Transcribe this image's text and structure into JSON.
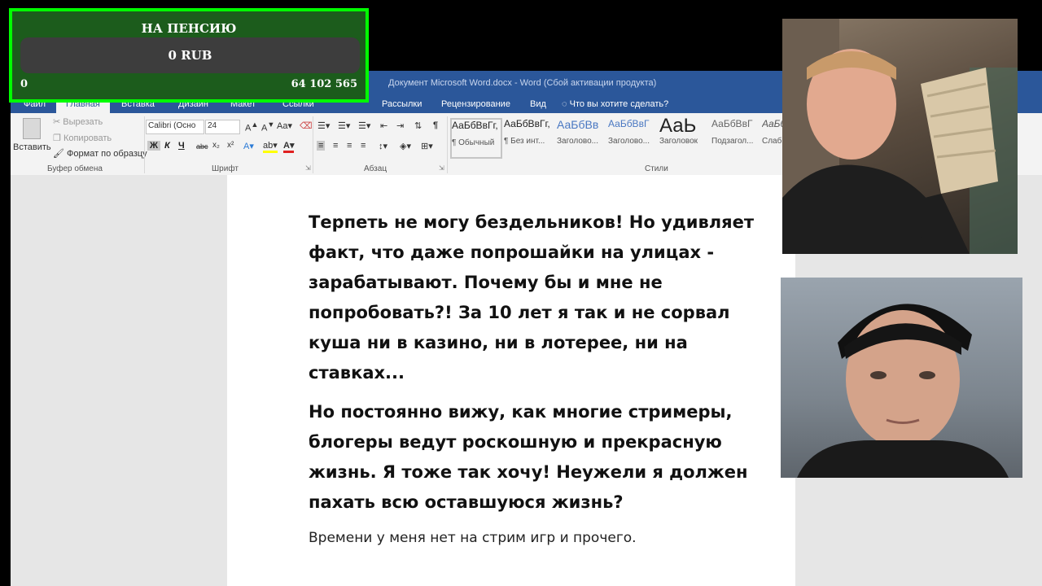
{
  "widget": {
    "title": "НА ПЕНСИЮ",
    "current": "0 RUB",
    "min": "0",
    "max": "64 102 565",
    "progress": 0
  },
  "word": {
    "window_title": "Документ Microsoft Word.docx - Word (Сбой активации продукта)",
    "tabs": [
      "Файл",
      "Главная",
      "Вставка",
      "Дизайн",
      "Макет",
      "Ссылки",
      "Рассылки",
      "Рецензирование",
      "Вид"
    ],
    "tell_me": "Что вы хотите сделать?",
    "clipboard": {
      "paste": "Вставить",
      "cut": "Вырезать",
      "copy": "Копировать",
      "format_painter": "Формат по образцу",
      "label": "Буфер обмена"
    },
    "font": {
      "name": "Calibri (Осно",
      "size": "24",
      "label": "Шрифт",
      "bold": "Ж",
      "italic": "К",
      "underline": "Ч",
      "strike": "abc"
    },
    "paragraph_label": "Абзац",
    "styles": {
      "label": "Стили",
      "items": [
        {
          "preview": "АаБбВвГг,",
          "name": "¶ Обычный"
        },
        {
          "preview": "АаБбВвГг,",
          "name": "¶ Без инт..."
        },
        {
          "preview": "АаБбВв",
          "name": "Заголово..."
        },
        {
          "preview": "АаБбВвГ",
          "name": "Заголово..."
        },
        {
          "preview": "АаЬ",
          "name": "Заголовок"
        },
        {
          "preview": "АаБбВвГ",
          "name": "Подзагол..."
        },
        {
          "preview": "АаБбВ",
          "name": "Слаб"
        }
      ]
    },
    "document": {
      "para1": "Терпеть не могу бездельников! Но удивляет факт, что даже попрошайки на улицах - зарабатывают. Почему бы и мне не попробовать?! За 10 лет я так и не сорвал куша ни в казино, ни в лотерее, ни на ставках...",
      "para2": "Но постоянно вижу, как многие стримеры, блогеры ведут роскошную и прекрасную жизнь. Я тоже так хочу! Неужели я должен пахать всю оставшуюся жизнь?",
      "para3": "Времени у меня нет на стрим игр и прочего."
    }
  },
  "colors": {
    "word_blue": "#2b579a",
    "widget_border": "#00ff00",
    "widget_bg": "#1c5c1c"
  }
}
